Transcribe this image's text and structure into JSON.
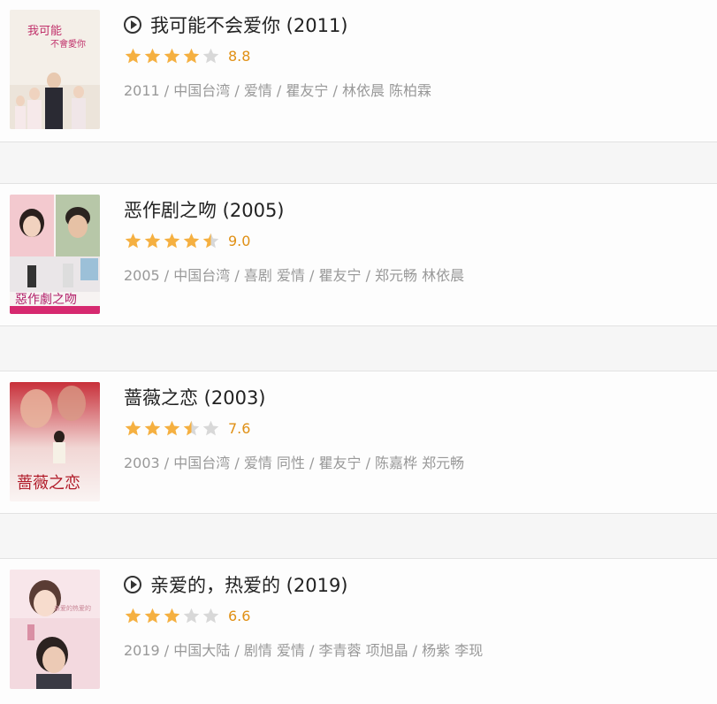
{
  "colors": {
    "star_on": "#f5b041",
    "star_off": "#d8d8d8",
    "score": "#e09015"
  },
  "movies": [
    {
      "title": "我可能不会爱你 (2011)",
      "has_play": true,
      "stars": 4,
      "score": "8.8",
      "meta": "2011 / 中国台湾 / 爱情 / 瞿友宁 / 林依晨 陈柏霖",
      "poster_icon": "poster-image"
    },
    {
      "title": "恶作剧之吻 (2005)",
      "has_play": false,
      "stars": 4.5,
      "score": "9.0",
      "meta": "2005 / 中国台湾 / 喜剧 爱情 / 瞿友宁 / 郑元畅 林依晨",
      "poster_icon": "poster-image"
    },
    {
      "title": "蔷薇之恋 (2003)",
      "has_play": false,
      "stars": 3.5,
      "score": "7.6",
      "meta": "2003 / 中国台湾 / 爱情 同性 / 瞿友宁 / 陈嘉桦 郑元畅",
      "poster_icon": "poster-image"
    },
    {
      "title": "亲爱的，热爱的 (2019)",
      "has_play": true,
      "stars": 3,
      "score": "6.6",
      "meta": "2019 / 中国大陆 / 剧情 爱情 / 李青蓉 项旭晶 / 杨紫 李现",
      "poster_icon": "poster-image"
    }
  ]
}
